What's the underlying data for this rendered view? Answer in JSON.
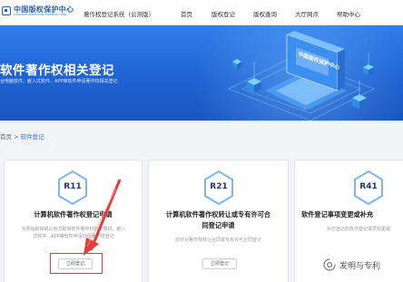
{
  "header": {
    "logo_cn": "中国版权保护中心",
    "logo_en": "COPYRIGHT PROTECTION CENTER OF CHINA",
    "site_title": "著作权登记系统（公测版）",
    "nav": [
      "首页",
      "版权登记",
      "版权查询",
      "大厅网点",
      "帮助中心"
    ]
  },
  "banner": {
    "title": "软件著作权相关登记",
    "subtitle": "台电脑软件、嵌入式软件、APP等软件申请著作权相关登记",
    "art_text": "中国版权保护中心"
  },
  "breadcrumb": {
    "home": "首页",
    "separator": ">",
    "current": "软件登记"
  },
  "cards": [
    {
      "code": "R11",
      "title_lines": [
        "计算机软件著作权登记申请"
      ],
      "desc_lines": [
        "为原始取得或从他方取得软件著作权的计算机、嵌入",
        "式软件、APP等软件申请办理著作权登记"
      ],
      "button": "立即登记"
    },
    {
      "code": "R21",
      "title_lines": [
        "计算机软件著作权转让或专有许可合",
        "同登记申请"
      ],
      "desc_lines": [
        "仅针对著作权转让合同或专有许可合同登记"
      ],
      "button": "立即登记"
    },
    {
      "code": "R41",
      "title_lines": [
        "软件登记事项变更或补充"
      ],
      "desc_lines": [
        "对已登记的软件登记事项变更或"
      ],
      "button": ""
    }
  ],
  "watermark": {
    "text": "发明与专利"
  },
  "colors": {
    "brand_blue": "#1f5fbf",
    "banner_blue": "#1f63d2",
    "annotation_red": "#e53b3b"
  }
}
